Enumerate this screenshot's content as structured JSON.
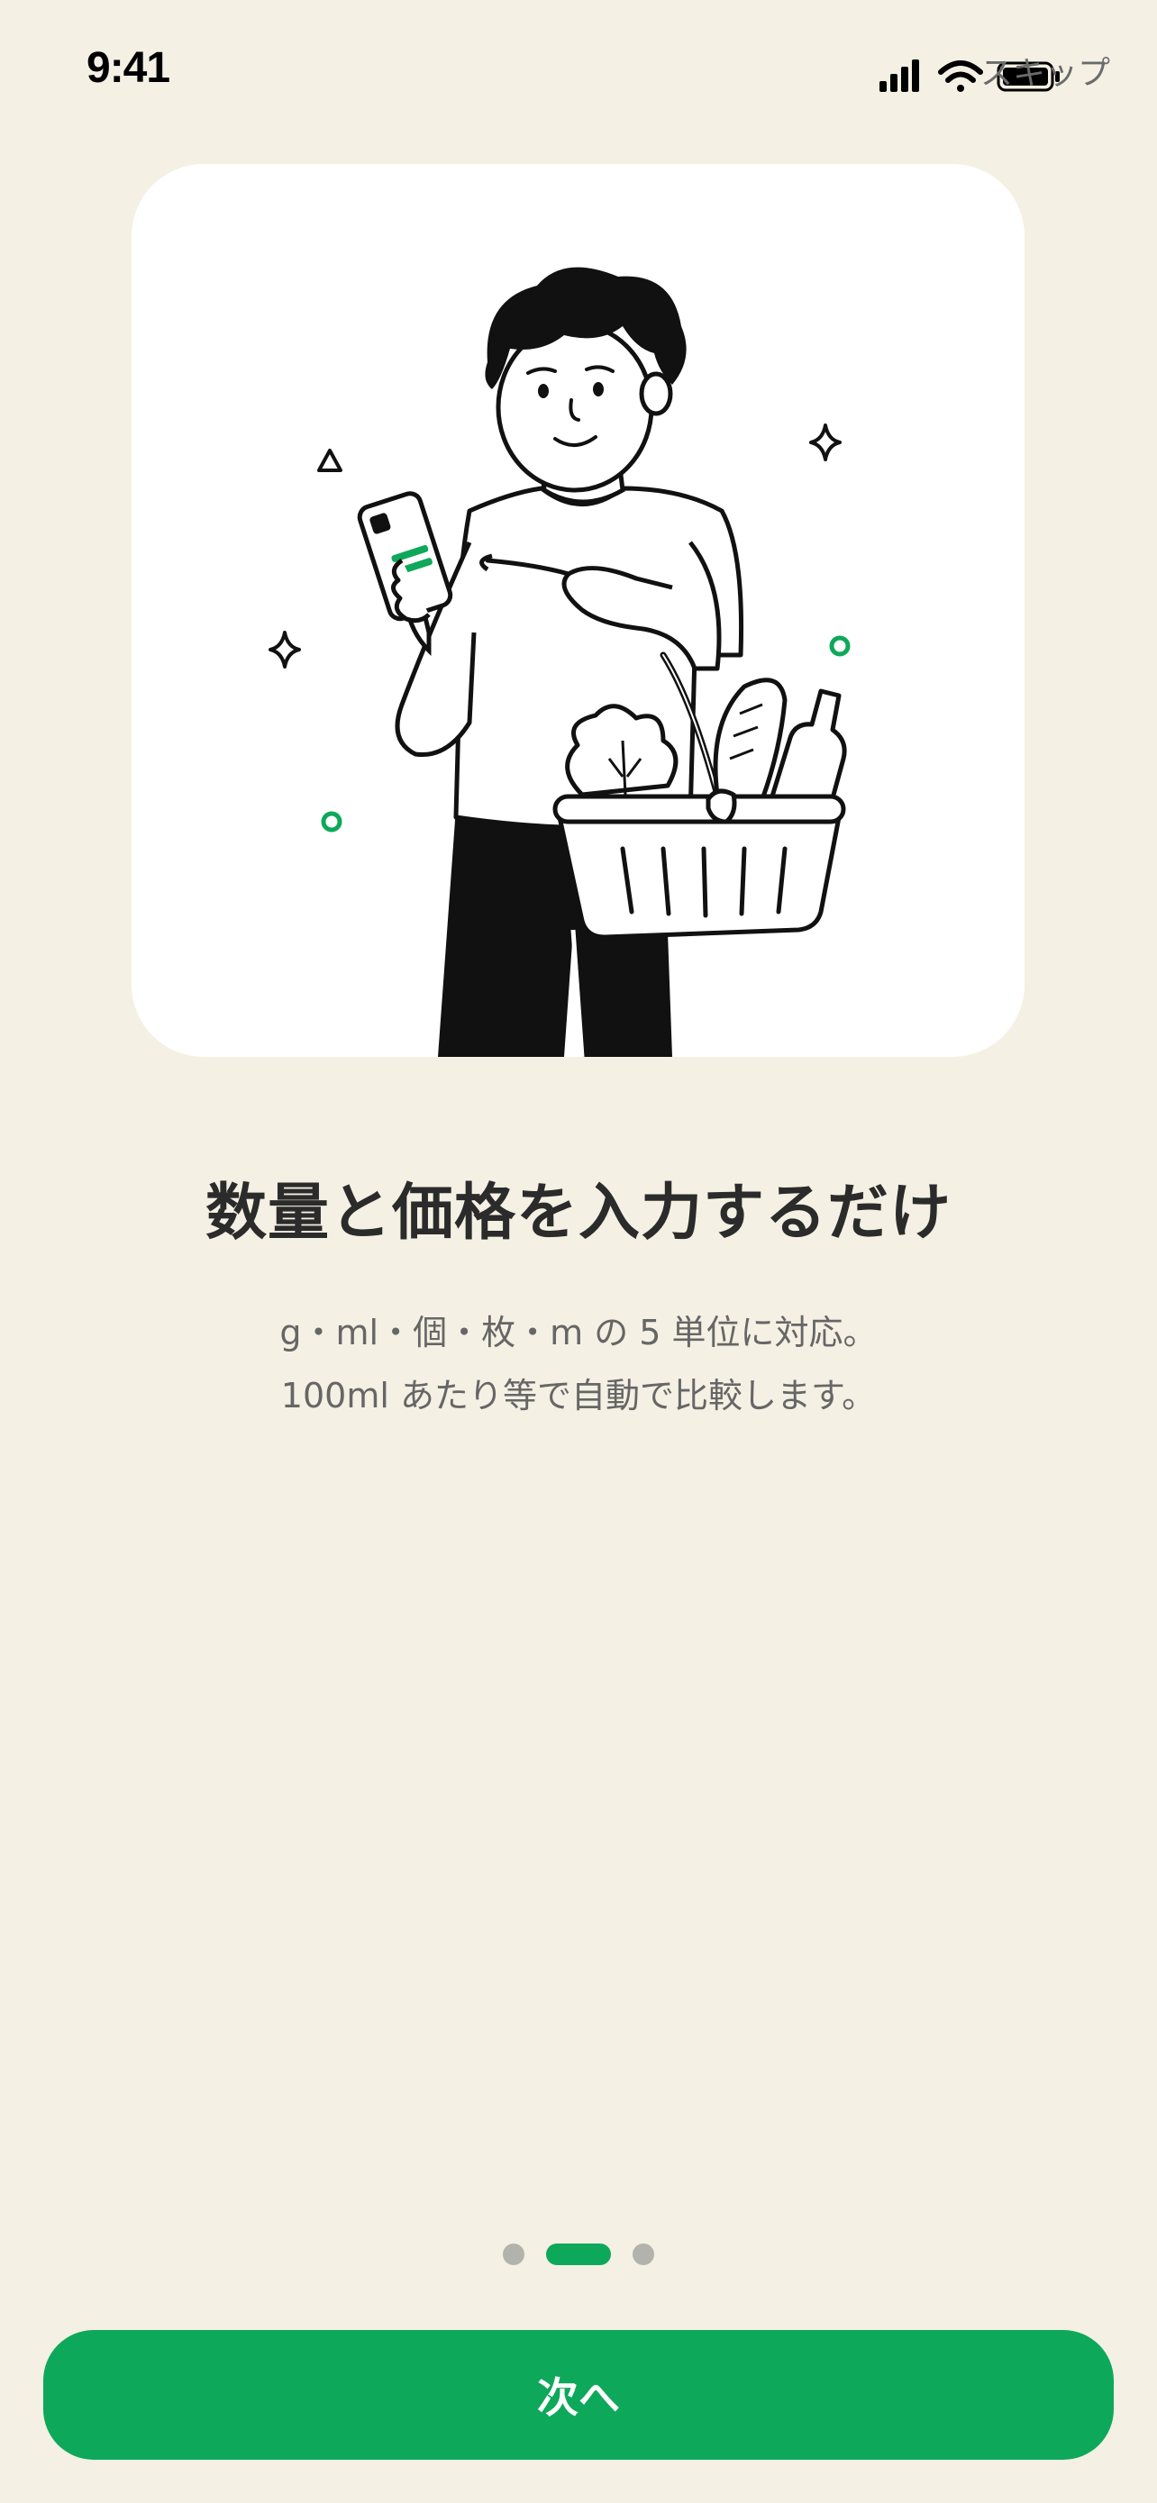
{
  "status_bar": {
    "time": "9:41",
    "icons": [
      "cellular-signal-icon",
      "wifi-icon",
      "battery-icon"
    ]
  },
  "header": {
    "skip_label": "スキップ"
  },
  "hero": {
    "illustration": "person-shopping-with-phone-and-basket",
    "accent_color": "#0ea85a"
  },
  "content": {
    "title": "数量と価格を入力するだけ",
    "description_line1": "g・ml・個・枚・m の 5 単位に対応。",
    "description_line2": "100ml あたり等で自動で比較します。"
  },
  "pager": {
    "total": 3,
    "current": 2
  },
  "footer": {
    "next_label": "次へ",
    "button_color": "#0ea85a"
  },
  "colors": {
    "background": "#f4f0e3",
    "card": "#ffffff",
    "accent": "#0ea85a",
    "title_text": "#2b2b2b",
    "body_text": "#666666"
  }
}
